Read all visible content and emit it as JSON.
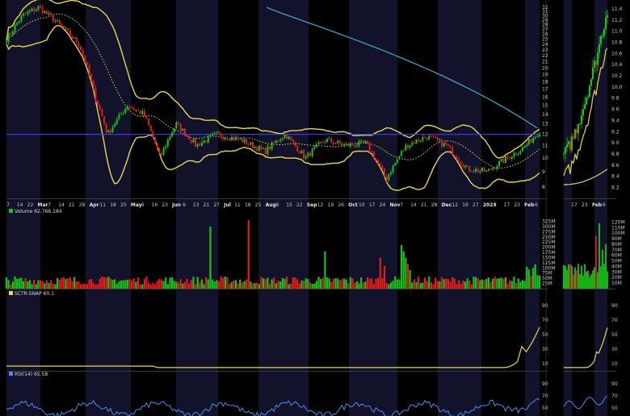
{
  "chart_data": {
    "type": "candlestick",
    "x_labels_main": [
      "7",
      "14",
      "22",
      "Mar",
      "7",
      "14",
      "21",
      "28",
      "Apr",
      "11",
      "18",
      "25",
      "May",
      "9",
      "16",
      "23",
      "Jun",
      "6",
      "13",
      "21",
      "27",
      "Jul",
      "11",
      "18",
      "25",
      "Aug",
      "8",
      "15",
      "22",
      "Sep",
      "12",
      "19",
      "26",
      "Oct",
      "10",
      "17",
      "24",
      "Nov",
      "7",
      "14",
      "21",
      "28",
      "Dec",
      "12",
      "19",
      "27",
      "2023",
      "9",
      "17",
      "23",
      "Feb",
      "6"
    ],
    "x_labels_bold": [
      "Mar",
      "Apr",
      "May",
      "Jun",
      "Jul",
      "Aug",
      "Sep",
      "Oct",
      "Nov",
      "Dec",
      "2023",
      "Feb"
    ],
    "x_labels_zoom": [
      "17",
      "23",
      "Feb",
      "6"
    ],
    "price_axis_main": [
      "32",
      "31",
      "30",
      "29",
      "28",
      "27",
      "26",
      "25",
      "24",
      "23",
      "22",
      "21",
      "20",
      "19",
      "18",
      "17",
      "16",
      "15",
      "14",
      "13",
      "12",
      "11",
      "10",
      "9",
      "8"
    ],
    "price_axis_zoom": [
      "11.4",
      "11.2",
      "11.0",
      "10.8",
      "10.6",
      "10.4",
      "10.2",
      "10.0",
      "9.8",
      "9.6",
      "9.4",
      "9.2",
      "9.0",
      "8.8",
      "8.6",
      "8.4",
      "8.2"
    ],
    "volume_panel": {
      "label": "Volume 62,766,184",
      "axis_main": [
        "325M",
        "300M",
        "275M",
        "250M",
        "225M",
        "200M",
        "175M",
        "150M",
        "125M",
        "100M",
        "75M",
        "50M",
        "25M"
      ],
      "axis_zoom": [
        "120M",
        "110M",
        "100M",
        "90M",
        "80M",
        "70M",
        "60M",
        "50M",
        "40M",
        "30M",
        "20M",
        "10M"
      ]
    },
    "sctr_panel": {
      "label": "SCTR-SNAP 60.1",
      "value": 60.1,
      "axis": [
        "90",
        "70",
        "50",
        "30",
        "10"
      ]
    },
    "rsi_panel": {
      "label": "RSI(14) 65.58",
      "value": 65.58,
      "axis": [
        "90",
        "70",
        "50"
      ]
    },
    "horizontal_line_price": 12,
    "last_close": 12,
    "colors": {
      "up": "#19c319",
      "down": "#e01e1e",
      "bollinger": "#e8d84a",
      "sma_long": "#3fb0c8",
      "horizontal_line": "#3a3ae0",
      "rsi": "#4a8ee8",
      "band_shade": "#12122a"
    }
  }
}
